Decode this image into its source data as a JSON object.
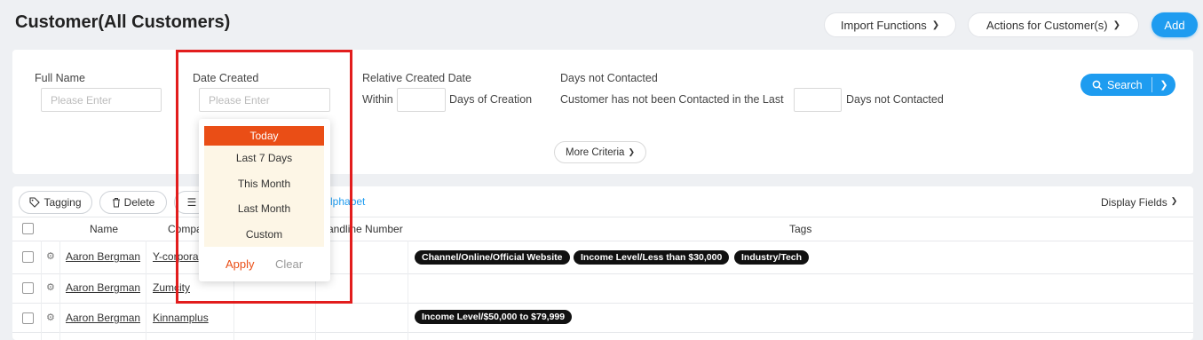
{
  "header": {
    "title": "Customer(All Customers)",
    "import_label": "Import Functions",
    "actions_label": "Actions for Customer(s)",
    "add_label": "Add"
  },
  "filters": {
    "full_name": {
      "label": "Full Name",
      "placeholder": "Please Enter"
    },
    "date_created": {
      "label": "Date Created",
      "placeholder": "Please Enter"
    },
    "relative_created": {
      "label": "Relative Created Date",
      "prefix": "Within",
      "suffix": "Days of Creation"
    },
    "days_not_contacted": {
      "label": "Days not Contacted",
      "prefix": "Customer has not been Contacted in the Last",
      "suffix": "Days not Contacted"
    },
    "search_label": "Search",
    "more_label": "More Criteria"
  },
  "toolbar": {
    "tagging_label": "Tagging",
    "delete_label": "Delete",
    "link_text": "lphabet",
    "display_fields_label": "Display Fields"
  },
  "table": {
    "headers": {
      "name": "Name",
      "company": "Compa",
      "landline": "andline Number",
      "tags": "Tags"
    },
    "rows": [
      {
        "name": "Aaron Bergman",
        "company": "Y-corpora",
        "tags": [
          "Channel/Online/Official Website",
          "Income Level/Less than $30,000",
          "Industry/Tech"
        ]
      },
      {
        "name": "Aaron Bergman",
        "company": "Zumcity",
        "tags": []
      },
      {
        "name": "Aaron Bergman",
        "company": "Kinnamplus",
        "tags": [
          "Income Level/$50,000 to $79,999"
        ]
      }
    ]
  },
  "date_dropdown": {
    "options": [
      "Today",
      "Last 7 Days",
      "This Month",
      "Last Month",
      "Custom"
    ],
    "selected": "Today",
    "apply_label": "Apply",
    "clear_label": "Clear"
  },
  "colors": {
    "accent": "#1e9cf0",
    "selected": "#ea4e16",
    "highlight": "#e21d1d",
    "tag_bg": "#111111"
  },
  "icons": {
    "tag": "tag-icon",
    "trash": "trash-icon",
    "search": "search-icon",
    "chevron": "chevron-down-icon",
    "gear": "gear-icon",
    "layers": "layers-icon"
  }
}
